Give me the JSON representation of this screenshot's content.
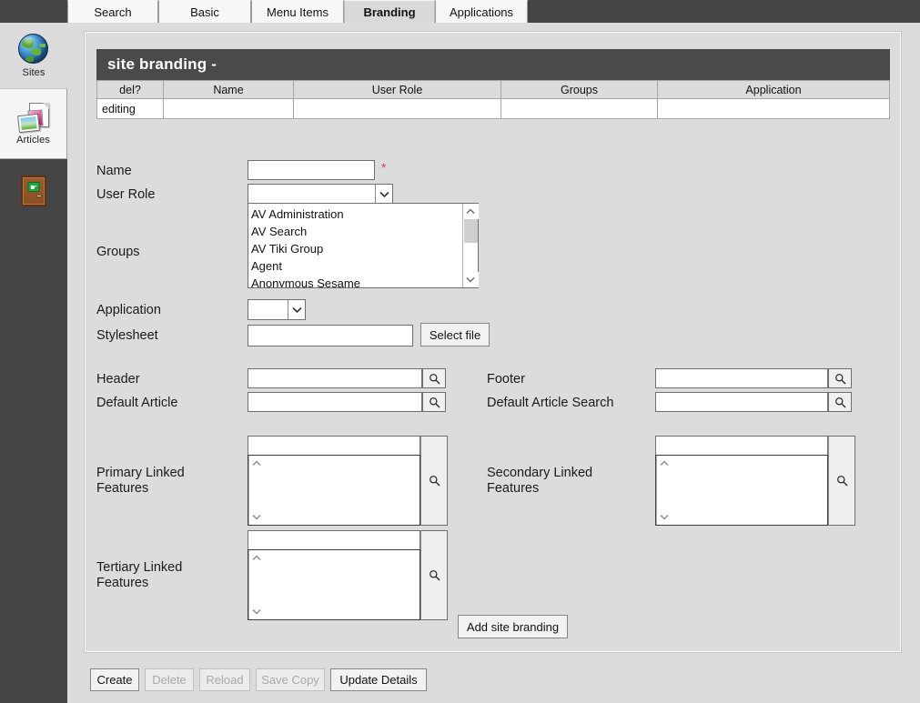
{
  "tabs": [
    {
      "id": "t-search",
      "label": "Search",
      "active": false
    },
    {
      "id": "t-basic",
      "label": "Basic",
      "active": false
    },
    {
      "id": "t-menu",
      "label": "Menu Items",
      "active": false
    },
    {
      "id": "t-brand",
      "label": "Branding",
      "active": true
    },
    {
      "id": "t-apps",
      "label": "Applications",
      "active": false
    }
  ],
  "sidebar": {
    "items": [
      {
        "label": "Sites",
        "icon": "globe-icon",
        "selected": false
      },
      {
        "label": "Articles",
        "icon": "articles-icon",
        "selected": true
      },
      {
        "label": "",
        "icon": "exit-door-icon",
        "selected": false
      }
    ],
    "exit_sign_glyph": "↳"
  },
  "grid": {
    "title": "site branding -",
    "columns": [
      "del?",
      "Name",
      "User Role",
      "Groups",
      "Application"
    ],
    "rows": [
      {
        "del": "editing",
        "name": "",
        "user_role": "",
        "groups": "",
        "application": ""
      }
    ]
  },
  "form": {
    "name": {
      "label": "Name",
      "value": "",
      "required_marker": "*"
    },
    "user_role": {
      "label": "User Role",
      "value": ""
    },
    "groups": {
      "label": "Groups",
      "options": [
        "AV Administration",
        "AV Search",
        "AV Tiki Group",
        "Agent",
        "Anonymous Sesame"
      ],
      "selected": ""
    },
    "application": {
      "label": "Application",
      "value": ""
    },
    "stylesheet": {
      "label": "Stylesheet",
      "value": "",
      "button_label": "Select file"
    },
    "header": {
      "label": "Header",
      "value": ""
    },
    "footer": {
      "label": "Footer",
      "value": ""
    },
    "default_article": {
      "label": "Default Article",
      "value": ""
    },
    "default_article_search": {
      "label": "Default Article Search",
      "value": ""
    },
    "primary_linked": {
      "label": "Primary Linked Features",
      "value": "",
      "items": []
    },
    "secondary_linked": {
      "label": "Secondary Linked Features",
      "value": "",
      "items": []
    },
    "tertiary_linked": {
      "label": "Tertiary Linked Features",
      "value": "",
      "items": []
    },
    "add_button": "Add site branding"
  },
  "footer_buttons": [
    {
      "label": "Create",
      "disabled": false
    },
    {
      "label": "Delete",
      "disabled": true
    },
    {
      "label": "Reload",
      "disabled": true
    },
    {
      "label": "Save Copy",
      "disabled": true
    },
    {
      "label": "Update Details",
      "disabled": false
    }
  ],
  "colors": {
    "chrome_dark": "#454545",
    "page_bg": "#dcdcdc",
    "grid_header_bg": "#4a4a4a",
    "required_red": "#e03a3a",
    "selected_tab_bg": "#d9d9d9"
  }
}
